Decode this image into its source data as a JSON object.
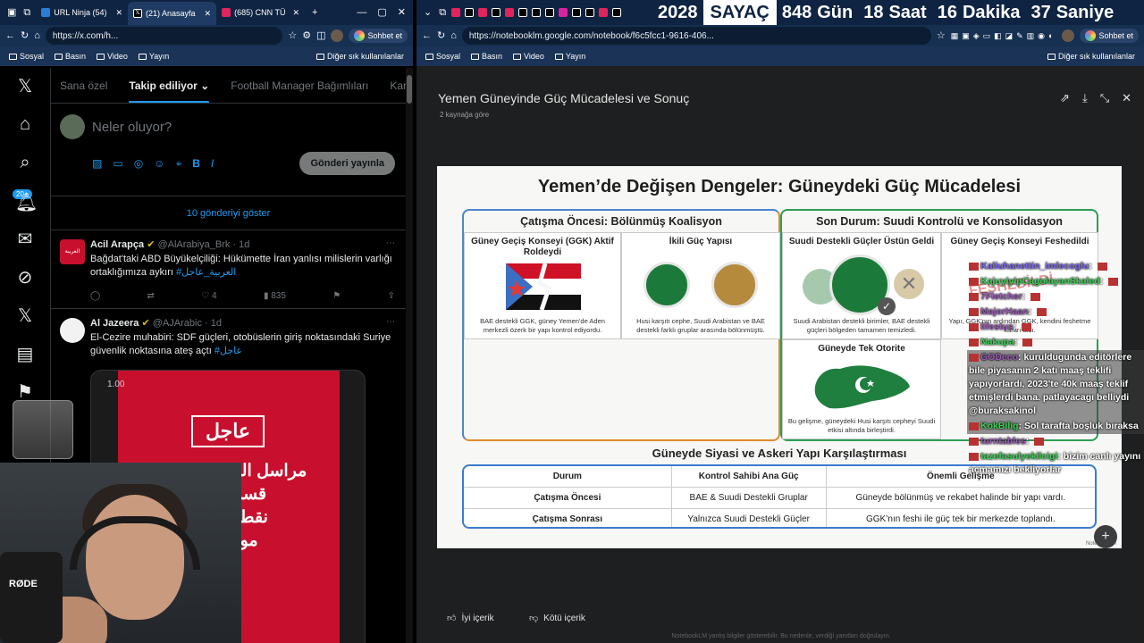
{
  "left_browser": {
    "tabs": [
      {
        "label": "URL Ninja (54)",
        "color": "#2b7cd3"
      },
      {
        "label": "(21) Anasayfa",
        "color": "#000000"
      },
      {
        "label": "(685) CNN TÜ",
        "color": "#e0245e"
      }
    ],
    "url": "https://x.com/h...",
    "bookmarks": [
      "Sosyal",
      "Basın",
      "Video",
      "Yayın"
    ],
    "other_bookmarks": "Diğer sık kullanılanlar",
    "copilot": "Sohbet et"
  },
  "x": {
    "tabs": [
      "Sana özel",
      "Takip ediliyor",
      "Football Manager Bağımlıları",
      "Kardeş"
    ],
    "notif_badge": "20+",
    "compose_placeholder": "Neler oluyor?",
    "post_button": "Gönderi yayınla",
    "show_posts": "10 gönderiyi göster",
    "tweets": [
      {
        "name": "Acil Arapça",
        "handle": "@AlArabiya_Brk",
        "time": "· 1d",
        "text": "Bağdat'taki ABD Büyükelçiliği: Hükümette İran yanlısı milislerin varlığı ortaklığımıza aykırı",
        "tag": "#العربية_عاجل",
        "replies": "",
        "likes": "4",
        "views": "835",
        "avatar_color": "#c8102e",
        "avatar_text": "العربية"
      },
      {
        "name": "Al Jazeera",
        "handle": "@AJArabic",
        "time": "· 1d",
        "text": "El-Cezire muhabiri: SDF güçleri, otobüslerin giriş noktasındaki Suriye güvenlik noktasına ateş açtı",
        "tag": "#عاجل",
        "avatar_color": "#f2f2f2"
      }
    ],
    "video": {
      "time": "1.00",
      "badge": "عاجل",
      "lines": [
        "مراسل الجزيرة: قوات",
        "قسد تطلق",
        "نقطة للأمن",
        "موقع دخ"
      ]
    }
  },
  "webcam": {
    "mic_brand": "RØDE"
  },
  "right_browser": {
    "url": "https://notebooklm.google.com/notebook/f6c5fcc1-9616-406...",
    "bookmarks": [
      "Sosyal",
      "Basın",
      "Video",
      "Yayın"
    ],
    "other_bookmarks": "Diğer sık kullanılanlar",
    "copilot": "Sohbet et"
  },
  "countdown": [
    {
      "value": "2028",
      "label": "SAYAÇ"
    },
    {
      "value": "848",
      "label": "Gün"
    },
    {
      "value": "18",
      "label": "Saat"
    },
    {
      "value": "16",
      "label": "Dakika"
    },
    {
      "value": "37",
      "label": "Saniye"
    }
  ],
  "notebook": {
    "title": "Yemen Güneyinde Güç Mücadelesi ve Sonuç",
    "subtitle": "2 kaynağa göre",
    "good": "İyi içerik",
    "bad": "Kötü içerik",
    "disclaimer": "NotebookLM yanlış bilgiler gösterebilir. Bu nedenle, verdiği yanıtları doğrulayın."
  },
  "slide": {
    "title": "Yemen’de Değişen Dengeler: Güneydeki Güç Mücadelesi",
    "panel_left": "Çatışma Öncesi: Bölünmüş Koalisyon",
    "panel_right": "Son Durum: Suudi Kontrolü ve Konsolidasyon",
    "cells": [
      {
        "title": "Güney Geçiş Konseyi (GGK) Aktif Roldeydi",
        "caption": "BAE destekli GGK, güney Yemen'de Aden merkezli özerk bir yapı kontrol ediyordu."
      },
      {
        "title": "İkili Güç Yapısı",
        "caption": "Husi karşıtı cephe, Suudi Arabistan ve BAE destekli farklı gruplar arasında bölünmüştü."
      },
      {
        "title": "Suudi Destekli Güçler Üstün Geldi",
        "caption": "Suudi Arabistan destekli birimler, BAE destekli güçleri bölgeden tamamen temizledi."
      },
      {
        "title": "Güney Geçiş Konseyi Feshedildi",
        "caption": "Yapı, GGK'nın ardından GGK, kendini feshetme kararı aldı."
      },
      {
        "title": "Güneyde Tek Otorite",
        "caption": "Bu gelişme, güneydeki Husi karşıtı cepheyi Suudi etkisi altında birleştirdi."
      }
    ],
    "stamp": "FESHEDİLDİ",
    "table_title": "Güneyde Siyasi ve Askeri Yapı Karşılaştırması",
    "table_headers": [
      "Durum",
      "Kontrol Sahibi Ana Güç",
      "Önemli Gelişme"
    ],
    "table_rows": [
      [
        "Çatışma Öncesi",
        "BAE & Suudi Destekli Gruplar",
        "Güneyde bölünmüş ve rekabet halinde bir yapı vardı."
      ],
      [
        "Çatışma Sonrası",
        "Yalnızca Suudi Destekli Güçler",
        "GGK’nın feshi ile güç tek bir merkezde toplandı."
      ]
    ],
    "watermark": "NotebookLM"
  },
  "chat": [
    {
      "user": "Kaliuhanettin_imlecoglu",
      "text": "",
      "color": "#7b68ee"
    },
    {
      "user": "KajuyiyipCagolayanSkaled",
      "text": "",
      "color": "#39d353"
    },
    {
      "user": "7Fletcher",
      "text": "",
      "color": "#9b59b6"
    },
    {
      "user": "MajorHaan",
      "text": "",
      "color": "#9b59b6"
    },
    {
      "user": "lifestus",
      "text": "",
      "color": "#9b59b6"
    },
    {
      "user": "Nakupa",
      "text": "",
      "color": "#39d353"
    },
    {
      "user": "GODeco",
      "text": "kuruldugunda editörlere bile piyasanın 2 katı maaş teklifi yapıyorlardı, 2023'te 40k maaş teklif etmişlerdi bana. patlayacagı belliydi @buraksakinol",
      "color": "#9b59b6"
    },
    {
      "user": "KokBilig",
      "text": "Sol tarafta boşluk bıraksa",
      "color": "#39d353"
    },
    {
      "user": "turntables",
      "text": "",
      "color": "#9b59b6"
    },
    {
      "user": "tazefasulyekilcigi",
      "text": "bizim canlı yayını açmamızı bekliyorlar",
      "color": "#39d353"
    }
  ]
}
